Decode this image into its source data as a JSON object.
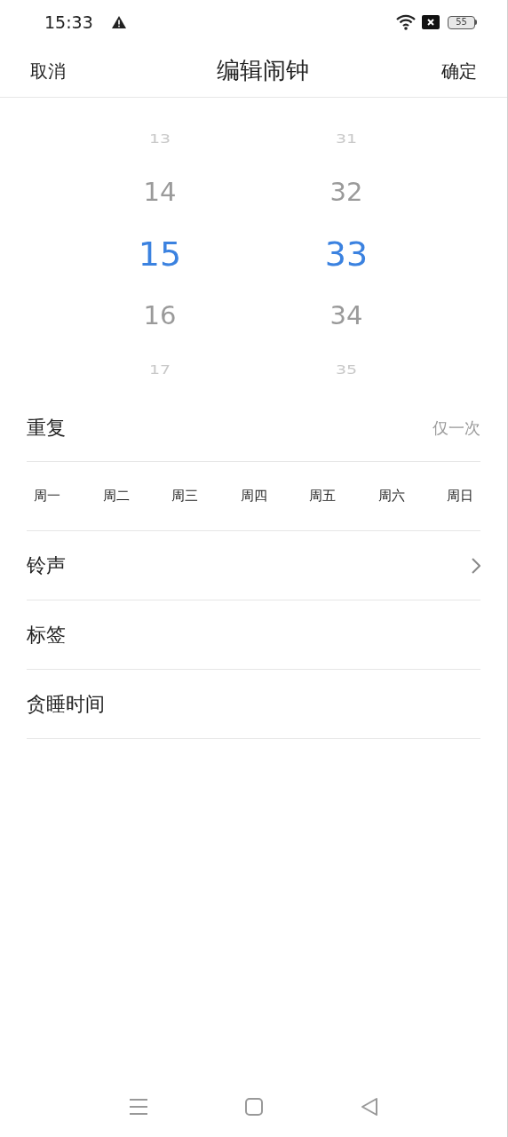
{
  "status_bar": {
    "time": "15:33",
    "battery": "55"
  },
  "header": {
    "cancel": "取消",
    "title": "编辑闹钟",
    "confirm": "确定"
  },
  "picker": {
    "hours": [
      {
        "label": "13",
        "selected": false
      },
      {
        "label": "14",
        "selected": false
      },
      {
        "label": "15",
        "selected": true
      },
      {
        "label": "16",
        "selected": false
      },
      {
        "label": "17",
        "selected": false
      }
    ],
    "minutes": [
      {
        "label": "31",
        "selected": false
      },
      {
        "label": "32",
        "selected": false
      },
      {
        "label": "33",
        "selected": true
      },
      {
        "label": "34",
        "selected": false
      },
      {
        "label": "35",
        "selected": false
      }
    ]
  },
  "repeat": {
    "label": "重复",
    "value": "仅一次"
  },
  "weekdays": [
    {
      "label": "周一",
      "selected": false
    },
    {
      "label": "周二",
      "selected": false
    },
    {
      "label": "周三",
      "selected": false
    },
    {
      "label": "周四",
      "selected": false
    },
    {
      "label": "周五",
      "selected": false
    },
    {
      "label": "周六",
      "selected": false
    },
    {
      "label": "周日",
      "selected": false
    }
  ],
  "settings": [
    {
      "label": "铃声",
      "chevron": true
    },
    {
      "label": "标签",
      "chevron": false
    },
    {
      "label": "贪睡时间",
      "chevron": false
    }
  ]
}
